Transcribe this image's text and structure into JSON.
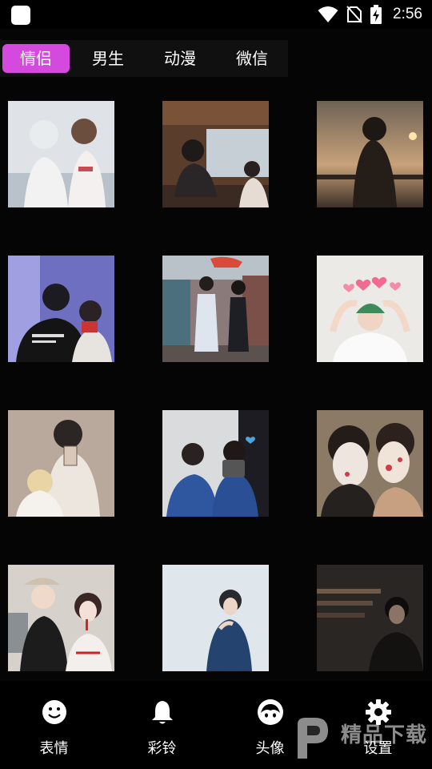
{
  "status_bar": {
    "time": "2:56",
    "icons": [
      "app-icon",
      "wifi-icon",
      "no-sim-icon",
      "battery-charging-icon"
    ]
  },
  "tabs": [
    {
      "label": "情侣",
      "active": true
    },
    {
      "label": "男生",
      "active": false
    },
    {
      "label": "动漫",
      "active": false
    },
    {
      "label": "微信",
      "active": false
    }
  ],
  "grid": {
    "items": [
      {
        "name": "avatar-couple-1"
      },
      {
        "name": "avatar-couple-2"
      },
      {
        "name": "avatar-couple-3"
      },
      {
        "name": "avatar-couple-4"
      },
      {
        "name": "avatar-couple-5"
      },
      {
        "name": "avatar-couple-6"
      },
      {
        "name": "avatar-couple-7"
      },
      {
        "name": "avatar-couple-8"
      },
      {
        "name": "avatar-couple-9"
      },
      {
        "name": "avatar-couple-10"
      },
      {
        "name": "avatar-couple-11"
      },
      {
        "name": "avatar-couple-12"
      }
    ]
  },
  "bottom_nav": [
    {
      "label": "表情",
      "icon": "smiley-icon"
    },
    {
      "label": "彩铃",
      "icon": "bell-icon"
    },
    {
      "label": "头像",
      "icon": "avatar-face-icon"
    },
    {
      "label": "设置",
      "icon": "gear-icon"
    }
  ],
  "watermark": {
    "text": "精品下载",
    "icon": "watermark-logo-icon"
  },
  "colors": {
    "accent": "#d449de",
    "background": "#050505",
    "tab_bar": "#101010"
  }
}
